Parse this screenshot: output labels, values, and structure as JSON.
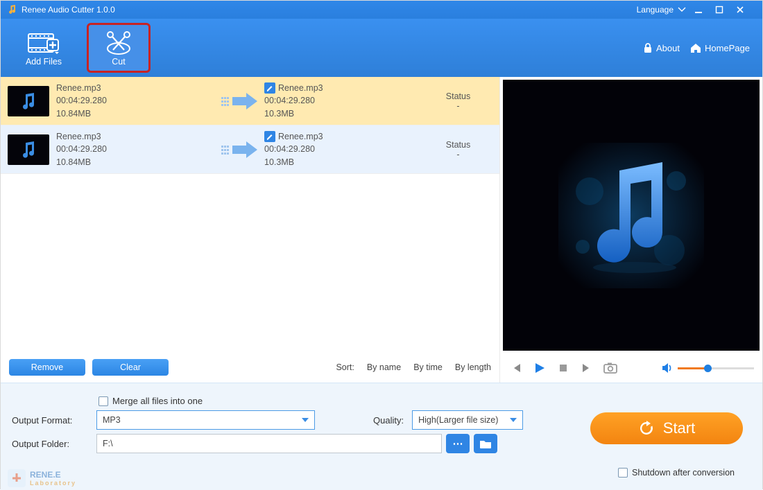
{
  "titlebar": {
    "app_title": "Renee Audio Cutter 1.0.0",
    "language": "Language"
  },
  "toolbar": {
    "add_files": "Add Files",
    "cut": "Cut",
    "about": "About",
    "homepage": "HomePage"
  },
  "files": [
    {
      "src_name": "Renee.mp3",
      "src_duration": "00:04:29.280",
      "src_size": "10.84MB",
      "out_name": "Renee.mp3",
      "out_duration": "00:04:29.280",
      "out_size": "10.3MB",
      "status_label": "Status",
      "status_value": "-"
    },
    {
      "src_name": "Renee.mp3",
      "src_duration": "00:04:29.280",
      "src_size": "10.84MB",
      "out_name": "Renee.mp3",
      "out_duration": "00:04:29.280",
      "out_size": "10.3MB",
      "status_label": "Status",
      "status_value": "-"
    }
  ],
  "listctrl": {
    "remove": "Remove",
    "clear": "Clear",
    "sort_label": "Sort:",
    "by_name": "By name",
    "by_time": "By time",
    "by_length": "By length"
  },
  "bottom": {
    "merge_label": "Merge all files into one",
    "output_format_label": "Output Format:",
    "output_format_value": "MP3",
    "quality_label": "Quality:",
    "quality_value": "High(Larger file size)",
    "output_folder_label": "Output Folder:",
    "output_folder_value": "F:\\",
    "start": "Start",
    "shutdown": "Shutdown after conversion"
  },
  "watermark": {
    "brand": "RENE.E",
    "sub": "Laboratory"
  }
}
